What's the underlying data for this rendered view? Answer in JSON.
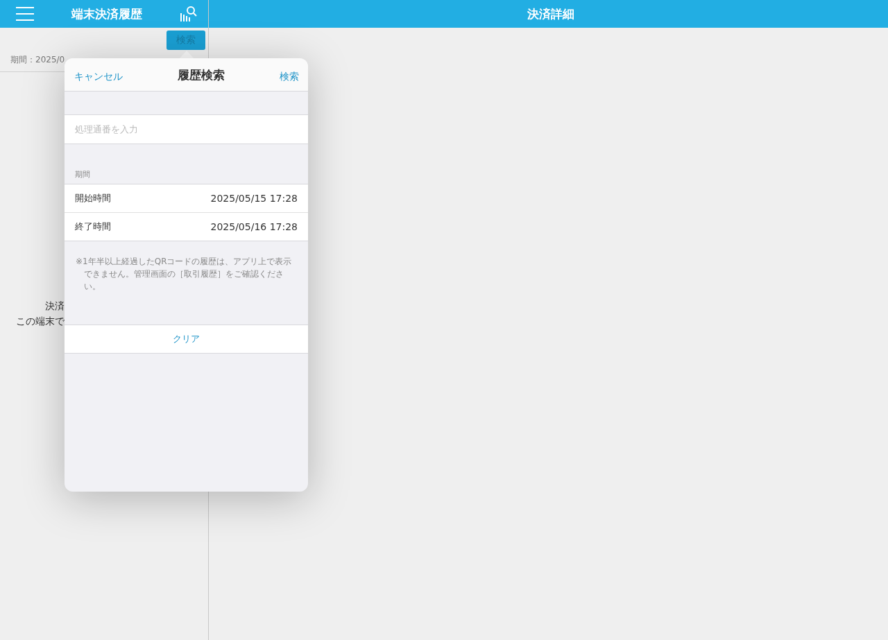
{
  "left_header": {
    "title": "端末決済履歴"
  },
  "right_header": {
    "title": "決済詳細"
  },
  "search_button": {
    "label": "検索"
  },
  "period_summary": "期間：2025/0",
  "empty_message": [
    "決済",
    "この端末で"
  ],
  "popover": {
    "cancel": "キャンセル",
    "title": "履歴検索",
    "search": "検索",
    "number_field": {
      "placeholder": "処理通番を入力"
    },
    "period_section": "期間",
    "rows": [
      {
        "label": "開始時間",
        "value": "2025/05/15 17:28"
      },
      {
        "label": "終了時間",
        "value": "2025/05/16 17:28"
      }
    ],
    "note": "※1年半以上経過したQRコードの履歴は、アプリ上で表示できません。管理画面の［取引履歴］をご確認ください。",
    "clear": "クリア"
  }
}
